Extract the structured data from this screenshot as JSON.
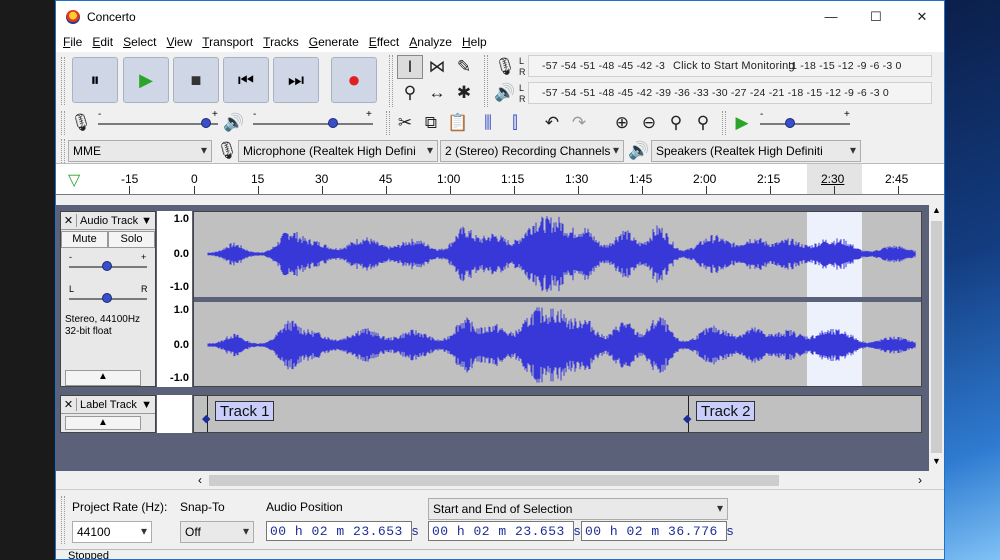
{
  "window": {
    "title": "Concerto",
    "minimize": "—",
    "maximize": "☐",
    "close": "✕"
  },
  "menu": [
    "File",
    "Edit",
    "Select",
    "View",
    "Transport",
    "Tracks",
    "Generate",
    "Effect",
    "Analyze",
    "Help"
  ],
  "transport": {
    "pause": "⏸",
    "play": "▶",
    "stop": "■",
    "skip_start": "⏮",
    "skip_end": "⏭",
    "record": "●"
  },
  "meters": {
    "record_scale": "-57 -54 -51 -48 -45 -42 -3",
    "monitor_prompt": "Click to Start Monitoring",
    "record_scale_right": "!1 -18 -15 -12  -9  -6  -3  0",
    "play_scale": "-57 -54 -51 -48 -45 -42 -39 -36 -33 -30 -27 -24 -21 -18 -15 -12  -9  -6  -3  0",
    "l": "L",
    "r": "R"
  },
  "device": {
    "host": "MME",
    "input": "Microphone (Realtek High Defini",
    "channels": "2 (Stereo) Recording Channels",
    "output": "Speakers (Realtek High Definiti"
  },
  "ruler": [
    "-15",
    "0",
    "15",
    "30",
    "45",
    "1:00",
    "1:15",
    "1:30",
    "1:45",
    "2:00",
    "2:15",
    "2:30",
    "2:45"
  ],
  "audio_track": {
    "name": "Audio Track",
    "mute": "Mute",
    "solo": "Solo",
    "gain_minus": "-",
    "gain_plus": "+",
    "pan_l": "L",
    "pan_r": "R",
    "info_line1": "Stereo, 44100Hz",
    "info_line2": "32-bit float",
    "scale": [
      "1.0",
      "0.0",
      "-1.0"
    ]
  },
  "label_track": {
    "name": "Label Track",
    "labels": [
      "Track 1",
      "Track 2"
    ]
  },
  "selection_toolbar": {
    "project_rate_label": "Project Rate (Hz):",
    "project_rate": "44100",
    "snap_to_label": "Snap-To",
    "snap_to": "Off",
    "audio_position_label": "Audio Position",
    "audio_position": "00 h 02 m 23.653 s",
    "selection_mode": "Start and End of Selection",
    "selection_start": "00 h 02 m 23.653 s",
    "selection_end": "00 h 02 m 36.776 s"
  },
  "status": "Stopped"
}
